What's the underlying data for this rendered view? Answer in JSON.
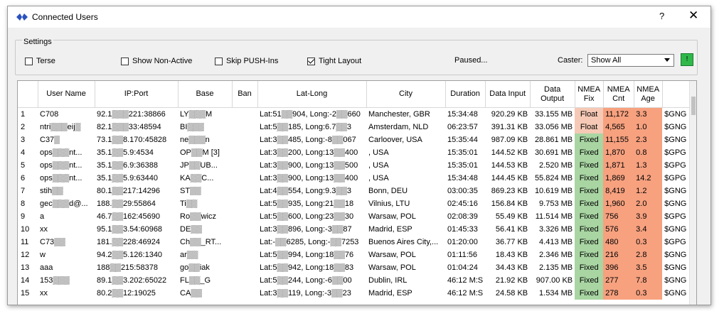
{
  "window": {
    "title": "Connected Users",
    "help_glyph": "?",
    "close_glyph": "✕"
  },
  "settings": {
    "group_label": "Settings",
    "options": [
      {
        "label": "Terse",
        "checked": false
      },
      {
        "label": "Show Non-Active",
        "checked": false
      },
      {
        "label": "Skip PUSH-Ins",
        "checked": false
      },
      {
        "label": "Tight Layout",
        "checked": true
      }
    ],
    "status": "Paused...",
    "caster_label": "Caster:",
    "caster_value": "Show All",
    "go_label": "!"
  },
  "colors": {
    "fixed": "#a8d5a2",
    "float": "#f5c9b5",
    "cnt_age": "#f7a17f",
    "go_button": "#2fb84a"
  },
  "table": {
    "headers": [
      "",
      "User Name",
      "IP:Port",
      "Base",
      "Ban",
      "Lat-Long",
      "City",
      "Duration",
      "Data Input",
      "Data Output",
      "NMEA Fix",
      "NMEA Cnt",
      "NMEA Age",
      ""
    ],
    "rows": [
      {
        "n": "1",
        "user": "C708",
        "ip": "92.1▒▒▒221:38866",
        "base": "LY▒▒▒M",
        "ban": "",
        "latlong": "Lat:51▒▒904, Long:-2▒▒660",
        "city": "Manchester, GBR",
        "duration": "15:34:48",
        "din": "920.29 KB",
        "dout": "33.155 MB",
        "fix": "Float",
        "cnt": "11,172",
        "age": "3.3",
        "sent": "$GNG"
      },
      {
        "n": "2",
        "user": "ntri▒▒▒eij▒",
        "ip": "82.1▒▒▒33:48594",
        "base": "BI▒▒▒",
        "ban": "",
        "latlong": "Lat:5▒▒185, Long:6.7▒▒3",
        "city": "Amsterdam, NLD",
        "duration": "06:23:57",
        "din": "391.31 KB",
        "dout": "33.056 MB",
        "fix": "Float",
        "cnt": "4,565",
        "age": "1.0",
        "sent": "$GNG"
      },
      {
        "n": "3",
        "user": "C37▒",
        "ip": "73.1▒▒8.170:45828",
        "base": "ne▒▒▒n",
        "ban": "",
        "latlong": "Lat:3▒▒485, Long:-8▒▒067",
        "city": "Carloover, USA",
        "duration": "15:35:44",
        "din": "987.09 KB",
        "dout": "28.861 MB",
        "fix": "Fixed",
        "cnt": "11,155",
        "age": "2.3",
        "sent": "$GNG"
      },
      {
        "n": "4",
        "user": "ops▒▒▒nt...",
        "ip": "35.1▒▒5.9:4534",
        "base": "OP▒▒M [3]",
        "ban": "",
        "latlong": "Lat:3▒▒200, Long:13▒▒400",
        "city": ", USA",
        "duration": "15:35:01",
        "din": "144.52 KB",
        "dout": "30.691 MB",
        "fix": "Fixed",
        "cnt": "1,870",
        "age": "0.8",
        "sent": "$GPG"
      },
      {
        "n": "5",
        "user": "ops▒▒▒nt...",
        "ip": "35.1▒▒6.9:36388",
        "base": "JP▒▒UB...",
        "ban": "",
        "latlong": "Lat:3▒▒900, Long:13▒▒500",
        "city": ", USA",
        "duration": "15:35:01",
        "din": "144.53 KB",
        "dout": "2.520 MB",
        "fix": "Fixed",
        "cnt": "1,871",
        "age": "1.3",
        "sent": "$GPG"
      },
      {
        "n": "6",
        "user": "ops▒▒▒nt...",
        "ip": "35.1▒▒5.9:63440",
        "base": "KA▒▒C...",
        "ban": "",
        "latlong": "Lat:3▒▒900, Long:13▒▒400",
        "city": ", USA",
        "duration": "15:34:48",
        "din": "144.45 KB",
        "dout": "55.824 MB",
        "fix": "Fixed",
        "cnt": "1,869",
        "age": "14.2",
        "sent": "$GPG"
      },
      {
        "n": "7",
        "user": "stih▒▒",
        "ip": "80.1▒▒217:14296",
        "base": "ST▒▒",
        "ban": "",
        "latlong": "Lat:4▒▒554, Long:9.3▒▒3",
        "city": "Bonn, DEU",
        "duration": "03:00:35",
        "din": "869.23 KB",
        "dout": "10.619 MB",
        "fix": "Fixed",
        "cnt": "8,419",
        "age": "1.2",
        "sent": "$GNG"
      },
      {
        "n": "8",
        "user": "gec▒▒▒d@...",
        "ip": "188.▒▒29:55864",
        "base": "Ti▒▒",
        "ban": "",
        "latlong": "Lat:5▒▒935, Long:21▒▒18",
        "city": "Vilnius, LTU",
        "duration": "02:45:16",
        "din": "156.84 KB",
        "dout": "9.753 MB",
        "fix": "Fixed",
        "cnt": "1,960",
        "age": "2.0",
        "sent": "$GNG"
      },
      {
        "n": "9",
        "user": "a",
        "ip": "46.7▒▒162:45690",
        "base": "Ro▒▒wicz",
        "ban": "",
        "latlong": "Lat:5▒▒600, Long:23▒▒30",
        "city": "Warsaw, POL",
        "duration": "02:08:39",
        "din": "55.49 KB",
        "dout": "11.514 MB",
        "fix": "Fixed",
        "cnt": "756",
        "age": "3.9",
        "sent": "$GPG"
      },
      {
        "n": "10",
        "user": "xx",
        "ip": "95.1▒▒3.54:60968",
        "base": "DE▒▒",
        "ban": "",
        "latlong": "Lat:3▒▒896, Long:-3▒▒87",
        "city": "Madrid, ESP",
        "duration": "01:45:33",
        "din": "56.41 KB",
        "dout": "3.326 MB",
        "fix": "Fixed",
        "cnt": "576",
        "age": "3.4",
        "sent": "$GNG"
      },
      {
        "n": "11",
        "user": "C73▒▒",
        "ip": "181.▒▒228:46924",
        "base": "Ch▒▒_RT...",
        "ban": "",
        "latlong": "Lat:-▒▒6285, Long:-▒▒7253",
        "city": "Buenos Aires City,...",
        "duration": "01:20:00",
        "din": "36.77 KB",
        "dout": "4.413 MB",
        "fix": "Fixed",
        "cnt": "480",
        "age": "0.3",
        "sent": "$GPG"
      },
      {
        "n": "12",
        "user": "w",
        "ip": "94.2▒▒5.126:1340",
        "base": "ar▒▒",
        "ban": "",
        "latlong": "Lat:5▒▒994, Long:18▒▒76",
        "city": "Warsaw, POL",
        "duration": "01:11:56",
        "din": "18.43 KB",
        "dout": "2.346 MB",
        "fix": "Fixed",
        "cnt": "216",
        "age": "2.8",
        "sent": "$GNG"
      },
      {
        "n": "13",
        "user": "aaa",
        "ip": "188▒▒215:58378",
        "base": "go▒▒iak",
        "ban": "",
        "latlong": "Lat:5▒▒942, Long:18▒▒83",
        "city": "Warsaw, POL",
        "duration": "01:04:24",
        "din": "34.43 KB",
        "dout": "2.135 MB",
        "fix": "Fixed",
        "cnt": "396",
        "age": "3.5",
        "sent": "$GNG"
      },
      {
        "n": "14",
        "user": "153▒▒▒",
        "ip": "89.1▒▒3.202:65022",
        "base": "FL▒▒_G",
        "ban": "",
        "latlong": "Lat:5▒▒244, Long:-6▒▒00",
        "city": "Dublin, IRL",
        "duration": "46:12 M:S",
        "din": "21.92 KB",
        "dout": "907.00 KB",
        "fix": "Fixed",
        "cnt": "277",
        "age": "7.8",
        "sent": "$GNG"
      },
      {
        "n": "15",
        "user": "xx",
        "ip": "80.2▒▒12:19025",
        "base": "CA▒▒",
        "ban": "",
        "latlong": "Lat:3▒▒119, Long:-3▒▒23",
        "city": "Madrid, ESP",
        "duration": "46:12 M:S",
        "din": "24.58 KB",
        "dout": "1.534 MB",
        "fix": "Fixed",
        "cnt": "278",
        "age": "0.3",
        "sent": "$GNG"
      }
    ]
  }
}
